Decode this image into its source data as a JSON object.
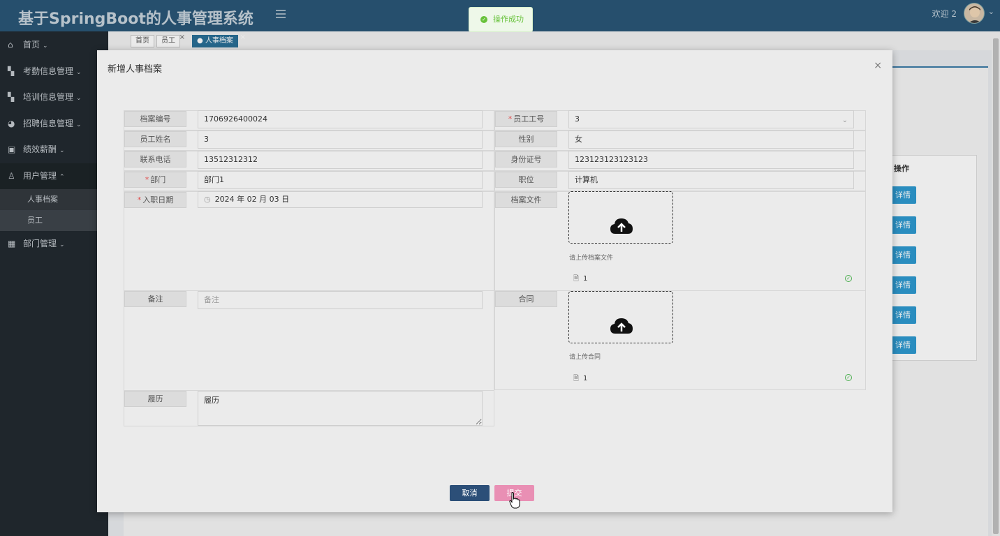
{
  "header": {
    "title": "基于SpringBoot的人事管理系统",
    "welcome": "欢迎 2"
  },
  "sidebar": {
    "items": [
      {
        "label": "首页",
        "icon": "home-icon"
      },
      {
        "label": "考勤信息管理",
        "icon": "grid-icon"
      },
      {
        "label": "培训信息管理",
        "icon": "grid-icon"
      },
      {
        "label": "招聘信息管理",
        "icon": "compass-icon"
      },
      {
        "label": "绩效薪酬",
        "icon": "id-card-icon"
      },
      {
        "label": "用户管理",
        "icon": "user-icon"
      },
      {
        "label": "部门管理",
        "icon": "apps-icon"
      }
    ],
    "sub": {
      "archive": "人事档案",
      "staff": "员工"
    }
  },
  "tabs": [
    {
      "label": "首页"
    },
    {
      "label": "员工"
    },
    {
      "label": "● 人事档案"
    }
  ],
  "background": {
    "op_header": "操作",
    "detail_label": "详情"
  },
  "toast": {
    "text": "操作成功"
  },
  "modal": {
    "title": "新增人事档案",
    "close": "×",
    "fields": {
      "archive_no": {
        "label": "档案编号",
        "value": "1706926400024"
      },
      "emp_no": {
        "label": "员工工号",
        "value": "3"
      },
      "emp_name": {
        "label": "员工姓名",
        "value": "3"
      },
      "gender": {
        "label": "性别",
        "value": "女"
      },
      "phone": {
        "label": "联系电话",
        "value": "13512312312"
      },
      "id_card": {
        "label": "身份证号",
        "value": "123123123123123"
      },
      "dept": {
        "label": "部门",
        "value": "部门1"
      },
      "position": {
        "label": "职位",
        "value": "计算机"
      },
      "entry_date": {
        "label": "入职日期",
        "value": "2024 年 02 月 03 日"
      },
      "archive_file": {
        "label": "档案文件",
        "tip": "请上传档案文件",
        "file": "1"
      },
      "remark": {
        "label": "备注",
        "placeholder": "备注"
      },
      "contract": {
        "label": "合同",
        "tip": "请上传合同",
        "file": "1"
      },
      "resume": {
        "label": "履历",
        "value": "履历"
      }
    },
    "buttons": {
      "cancel": "取消",
      "submit": "提交"
    }
  }
}
